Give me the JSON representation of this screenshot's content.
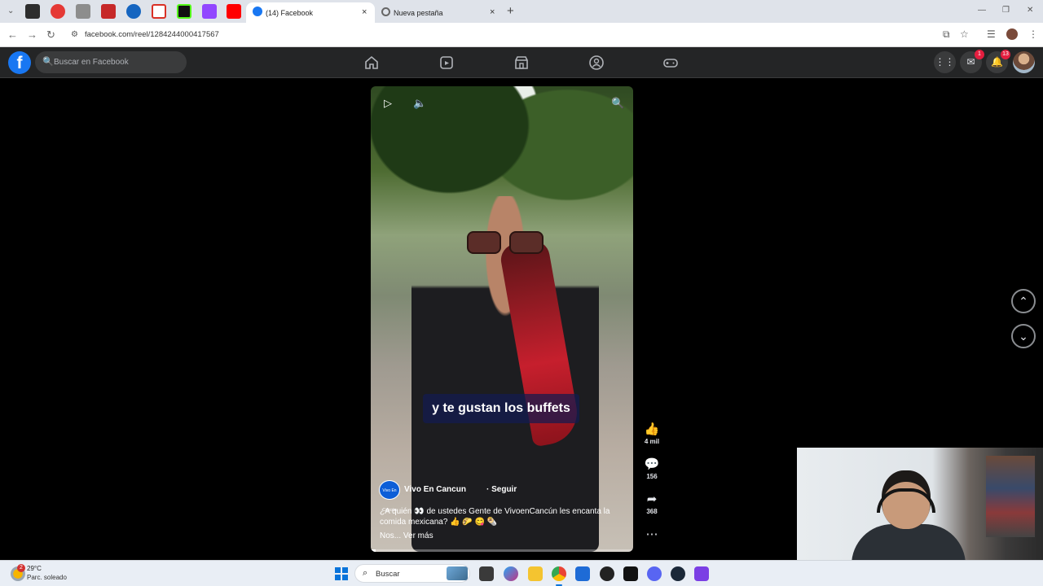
{
  "browser": {
    "tabs": [
      {
        "title": "(14) Facebook",
        "active": true
      },
      {
        "title": "Nueva pestaña",
        "active": false
      }
    ],
    "close_glyph": "×",
    "new_tab_glyph": "+",
    "url": "facebook.com/reel/1284244000417567"
  },
  "facebook": {
    "logo": "f",
    "search_placeholder": "Buscar en Facebook",
    "nav_icons": [
      "home-icon",
      "reels-icon",
      "marketplace-icon",
      "groups-icon",
      "gaming-icon"
    ],
    "messenger_badge": "1",
    "notifications_badge": "13"
  },
  "reel": {
    "caption": "y te gustan los buffets",
    "page_avatar_text": "Vivo En Cancún",
    "page_name": "Vivo En Cancun",
    "follow_label": "· Seguir",
    "description": "¿A quién 👀 de ustedes Gente de VivoenCancún les encanta la comida mexicana? 👍 🌮 😋 🌯",
    "see_more": "Nos... Ver más",
    "progress": 0.02,
    "actions": {
      "likes": "4 mil",
      "comments": "156",
      "shares": "368"
    }
  },
  "taskbar": {
    "weather_temp": "29°C",
    "weather_desc": "Parc. soleado",
    "weather_badge": "2",
    "search_label": "Buscar"
  },
  "colors": {
    "fb_blue": "#1877f2",
    "fb_header": "#242526",
    "badge_red": "#e41e3f"
  }
}
